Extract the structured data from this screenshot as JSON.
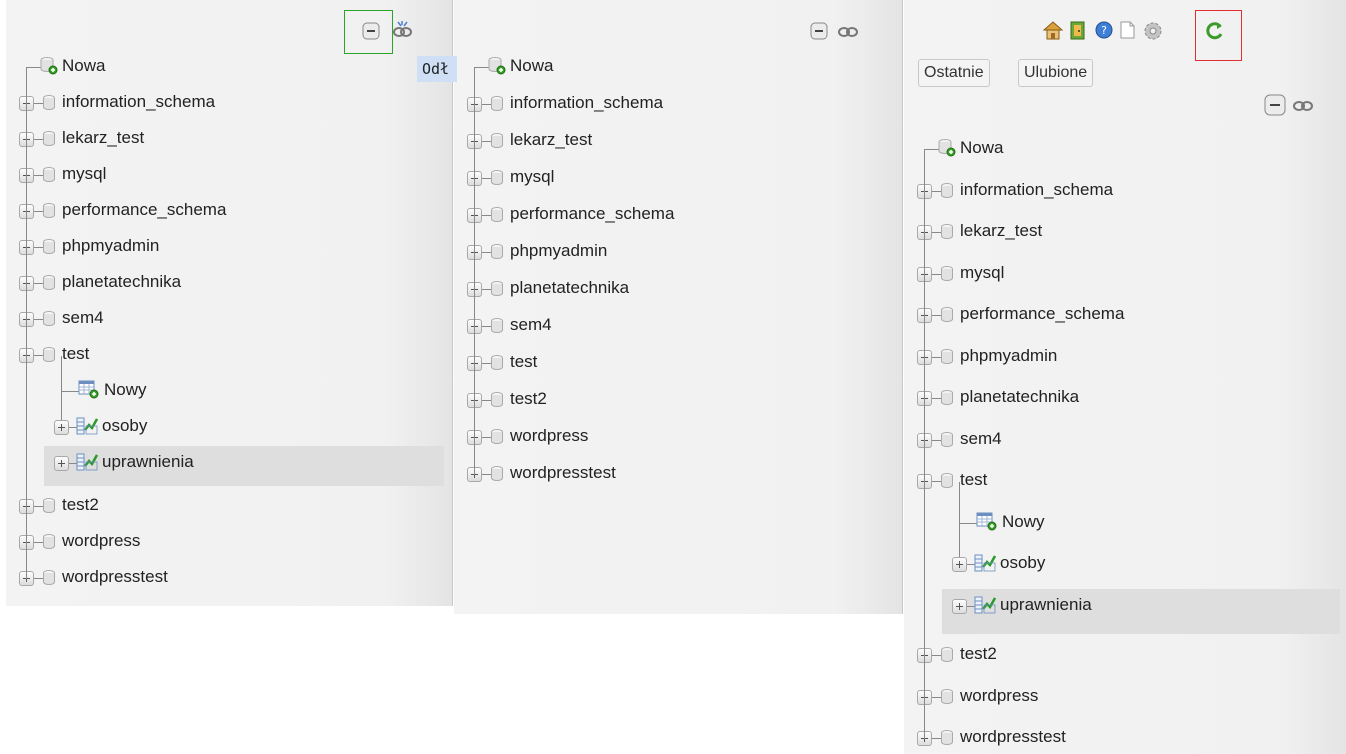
{
  "panel_left": {
    "new_db_label": "Nowa",
    "databases": [
      "information_schema",
      "lekarz_test",
      "mysql",
      "performance_schema",
      "phpmyadmin",
      "planetatechnika",
      "sem4",
      "test"
    ],
    "expanded_children": {
      "new_table_label": "Nowy",
      "tables": [
        "osoby",
        "uprawnienia"
      ]
    },
    "databases_after": [
      "test2",
      "wordpress",
      "wordpresstest"
    ],
    "overflow_text": "Odł",
    "collapse_icon": "collapse-all-icon",
    "link_icon": "unlink-icon"
  },
  "panel_middle": {
    "new_db_label": "Nowa",
    "databases": [
      "information_schema",
      "lekarz_test",
      "mysql",
      "performance_schema",
      "phpmyadmin",
      "planetatechnika",
      "sem4",
      "test",
      "test2",
      "wordpress",
      "wordpresstest"
    ],
    "collapse_icon": "collapse-all-icon",
    "link_icon": "link-icon"
  },
  "panel_right": {
    "toolbar_icons": [
      "home-icon",
      "logout-icon",
      "help-icon",
      "docs-icon",
      "settings-icon",
      "reload-icon"
    ],
    "tabs": [
      "Ostatnie",
      "Ulubione"
    ],
    "new_db_label": "Nowa",
    "databases": [
      "information_schema",
      "lekarz_test",
      "mysql",
      "performance_schema",
      "phpmyadmin",
      "planetatechnika",
      "sem4",
      "test"
    ],
    "expanded_children": {
      "new_table_label": "Nowy",
      "tables": [
        "osoby",
        "uprawnienia"
      ]
    },
    "databases_after": [
      "test2",
      "wordpress",
      "wordpresstest"
    ]
  },
  "colors": {
    "highlight_box_green": "#2aa52a",
    "highlight_box_red": "#e03030",
    "selected_row": "#dedede"
  }
}
